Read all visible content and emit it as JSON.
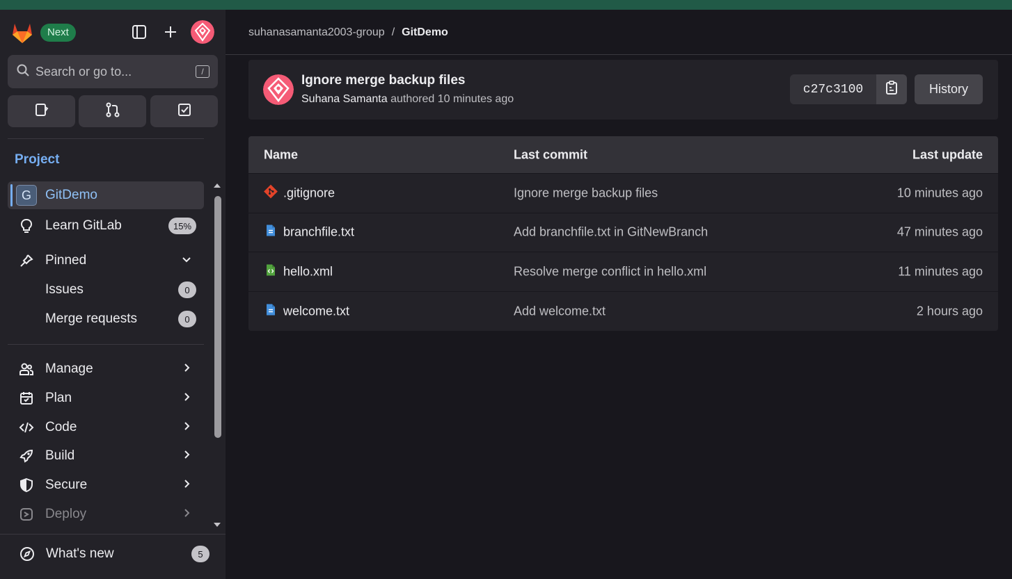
{
  "sidebar": {
    "next_label": "Next",
    "search_placeholder": "Search or go to...",
    "search_shortcut": "/",
    "section_title": "Project",
    "project_initial": "G",
    "project_name": "GitDemo",
    "learn_label": "Learn GitLab",
    "learn_progress": "15%",
    "pinned_label": "Pinned",
    "pinned_items": [
      {
        "label": "Issues",
        "count": "0"
      },
      {
        "label": "Merge requests",
        "count": "0"
      }
    ],
    "nav": [
      {
        "label": "Manage",
        "icon": "users-icon"
      },
      {
        "label": "Plan",
        "icon": "calendar-icon"
      },
      {
        "label": "Code",
        "icon": "code-icon"
      },
      {
        "label": "Build",
        "icon": "rocket-icon"
      },
      {
        "label": "Secure",
        "icon": "shield-icon"
      },
      {
        "label": "Deploy",
        "icon": "deploy-icon"
      }
    ],
    "whats_new_label": "What's new",
    "whats_new_count": "5"
  },
  "breadcrumb": {
    "group": "suhanasamanta2003-group",
    "separator": "/",
    "project": "GitDemo"
  },
  "commit": {
    "title": "Ignore merge backup files",
    "author": "Suhana Samanta",
    "meta": "authored 10 minutes ago",
    "sha": "c27c3100",
    "history_label": "History"
  },
  "files": {
    "headers": {
      "name": "Name",
      "last_commit": "Last commit",
      "last_update": "Last update"
    },
    "rows": [
      {
        "name": ".gitignore",
        "icon": "git-icon",
        "commit": "Ignore merge backup files",
        "updated": "10 minutes ago"
      },
      {
        "name": "branchfile.txt",
        "icon": "text-file-icon",
        "commit": "Add branchfile.txt in GitNewBranch",
        "updated": "47 minutes ago"
      },
      {
        "name": "hello.xml",
        "icon": "xml-file-icon",
        "commit": "Resolve merge conflict in hello.xml",
        "updated": "11 minutes ago"
      },
      {
        "name": "welcome.txt",
        "icon": "text-file-icon",
        "commit": "Add welcome.txt",
        "updated": "2 hours ago"
      }
    ]
  },
  "colors": {
    "accent": "#76aef2",
    "top_strip": "#215a47",
    "next_badge": "#1f7d4a",
    "gitlab_orange": "#fc6d26"
  }
}
